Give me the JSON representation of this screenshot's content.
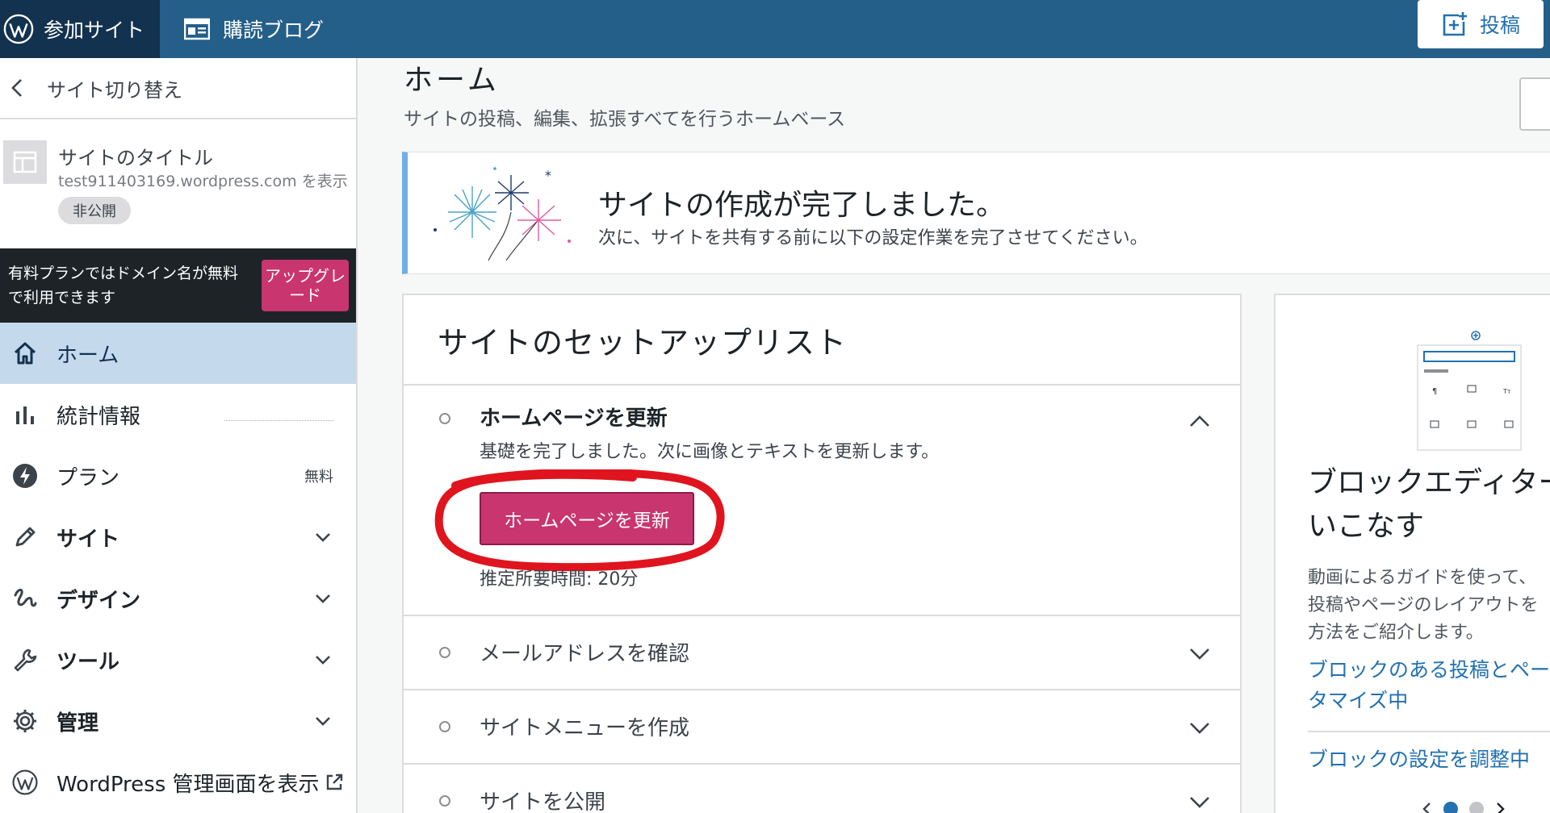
{
  "topbar": {
    "my_sites": "参加サイト",
    "reader": "購読ブログ",
    "write": "投稿"
  },
  "sidebar": {
    "switch_site": "サイト切り替え",
    "site_title": "サイトのタイトル",
    "site_url": "test911403169.wordpress.com を表示",
    "privacy_badge": "非公開",
    "promo_text": "有料プランではドメイン名が無料で利用できます",
    "upgrade": "アップグレード",
    "items": [
      {
        "label": "ホーム",
        "icon": "home-icon",
        "active": true
      },
      {
        "label": "統計情報",
        "icon": "stats-icon"
      },
      {
        "label": "プラン",
        "icon": "plan-icon",
        "tail": "無料"
      },
      {
        "label": "サイト",
        "icon": "pencil-icon",
        "dropdown": true
      },
      {
        "label": "デザイン",
        "icon": "design-icon",
        "dropdown": true
      },
      {
        "label": "ツール",
        "icon": "wrench-icon",
        "dropdown": true
      },
      {
        "label": "管理",
        "icon": "gear-icon",
        "dropdown": true
      },
      {
        "label": "WordPress 管理画面を表示",
        "icon": "wordpress-icon",
        "external": true
      }
    ]
  },
  "main": {
    "title": "ホーム",
    "subtitle": "サイトの投稿、編集、拡張すべてを行うホームベース",
    "celebration": {
      "title": "サイトの作成が完了しました。",
      "subtitle": "次に、サイトを共有する前に以下の設定作業を完了させてください。"
    },
    "checklist": {
      "title": "サイトのセットアップリスト",
      "tasks": [
        {
          "title": "ホームページを更新",
          "description": "基礎を完了しました。次に画像とテキストを更新します。",
          "button": "ホームページを更新",
          "time": "推定所要時間: 20分",
          "expanded": true
        },
        {
          "title": "メールアドレスを確認"
        },
        {
          "title": "サイトメニューを作成"
        },
        {
          "title": "サイトを公開"
        }
      ]
    },
    "sidecard": {
      "title_line1": "ブロックエディター",
      "title_line2": "いこなす",
      "desc_line1": "動画によるガイドを使って、",
      "desc_line2": "投稿やページのレイアウトを",
      "desc_line3": "方法をご紹介します。",
      "link1_line1": "ブロックのある投稿とペー",
      "link1_line2": "タマイズ中",
      "link2": "ブロックの設定を調整中"
    }
  },
  "colors": {
    "topbar": "#245f8a",
    "topbar_dark": "#12324f",
    "accent_pink": "#c9356e",
    "link_blue": "#2271b1",
    "active_nav": "#c5d9ed",
    "annotation_red": "#e0141e"
  }
}
